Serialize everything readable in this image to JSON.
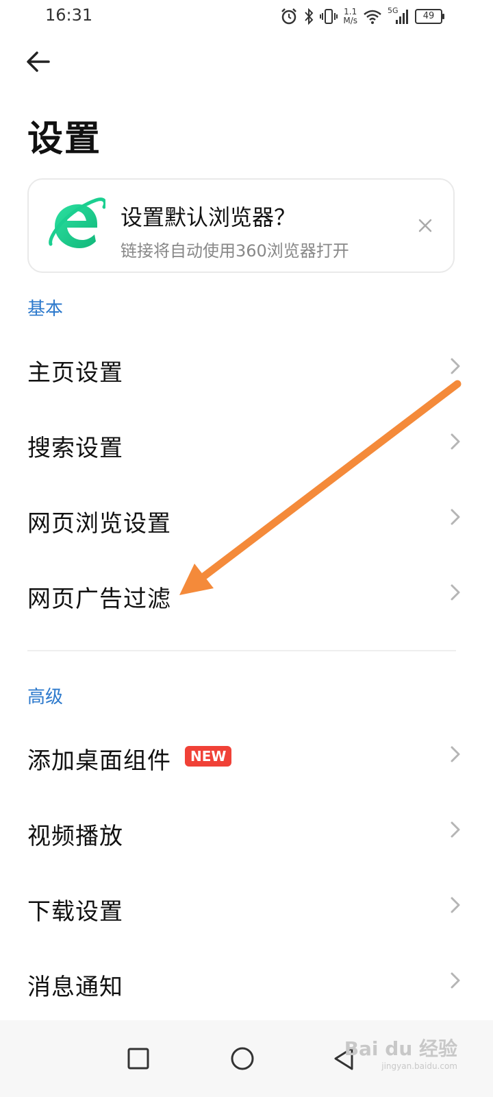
{
  "status_bar": {
    "time": "16:31",
    "net_speed_value": "1.1",
    "net_speed_unit": "M/s",
    "signal_label": "5G",
    "battery": "49",
    "icons": [
      "alarm-icon",
      "bluetooth-icon",
      "vibrate-icon",
      "wifi-icon",
      "signal-icon",
      "battery-icon"
    ]
  },
  "header": {
    "back_icon": "arrow-left-icon",
    "title": "设置"
  },
  "promo_card": {
    "logo_icon": "browser-e-logo",
    "title": "设置默认浏览器？",
    "subtitle": "链接将自动使用360浏览器打开",
    "close_icon": "close-icon",
    "logo_color": "#1bcf90"
  },
  "sections": {
    "basic": {
      "label": "基本",
      "items": [
        {
          "label": "主页设置"
        },
        {
          "label": "搜索设置"
        },
        {
          "label": "网页浏览设置"
        },
        {
          "label": "网页广告过滤"
        }
      ]
    },
    "advanced": {
      "label": "高级",
      "items": [
        {
          "label": "添加桌面组件",
          "badge": "NEW"
        },
        {
          "label": "视频播放"
        },
        {
          "label": "下载设置"
        },
        {
          "label": "消息通知"
        }
      ]
    }
  },
  "annotation": {
    "type": "arrow",
    "color": "#f48a3a",
    "points_to": "网页广告过滤"
  },
  "nav_bar": {
    "icons": [
      "recents-square-icon",
      "home-circle-icon",
      "back-triangle-icon"
    ]
  },
  "watermark": {
    "main": "Bai du 经验",
    "sub": "jingyan.baidu.com"
  },
  "colors": {
    "accent": "#2c79cc",
    "badge": "#f04137",
    "chevron": "#b5b5b5"
  }
}
